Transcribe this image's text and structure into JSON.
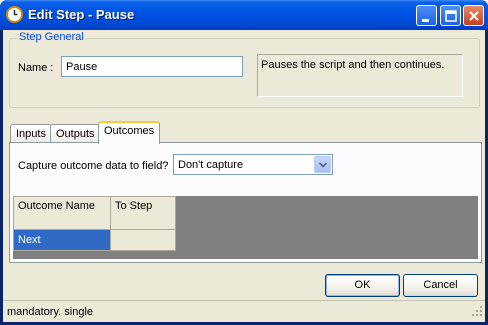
{
  "window": {
    "title": "Edit Step - Pause",
    "icon": "clock-icon"
  },
  "step_general": {
    "legend": "Step General",
    "name_label": "Name :",
    "name_value": "Pause",
    "description": "Pauses the script and then continues."
  },
  "tabs": [
    {
      "label": "Inputs",
      "active": false
    },
    {
      "label": "Outputs",
      "active": false
    },
    {
      "label": "Outcomes",
      "active": true
    }
  ],
  "outcomes": {
    "capture_label": "Capture outcome data to field?",
    "capture_value": "Don't capture",
    "columns": [
      "Outcome Name",
      "To Step"
    ],
    "rows": [
      {
        "outcome_name": "Next",
        "to_step": ""
      }
    ]
  },
  "buttons": {
    "ok": "OK",
    "cancel": "Cancel"
  },
  "status": {
    "text": "mandatory. single"
  },
  "colors": {
    "titlebar": "#0054e3",
    "selection": "#316ac5",
    "dialog_bg": "#ece9d8",
    "legend_text": "#0046d5",
    "active_tab_accent": "#ffc83c"
  }
}
